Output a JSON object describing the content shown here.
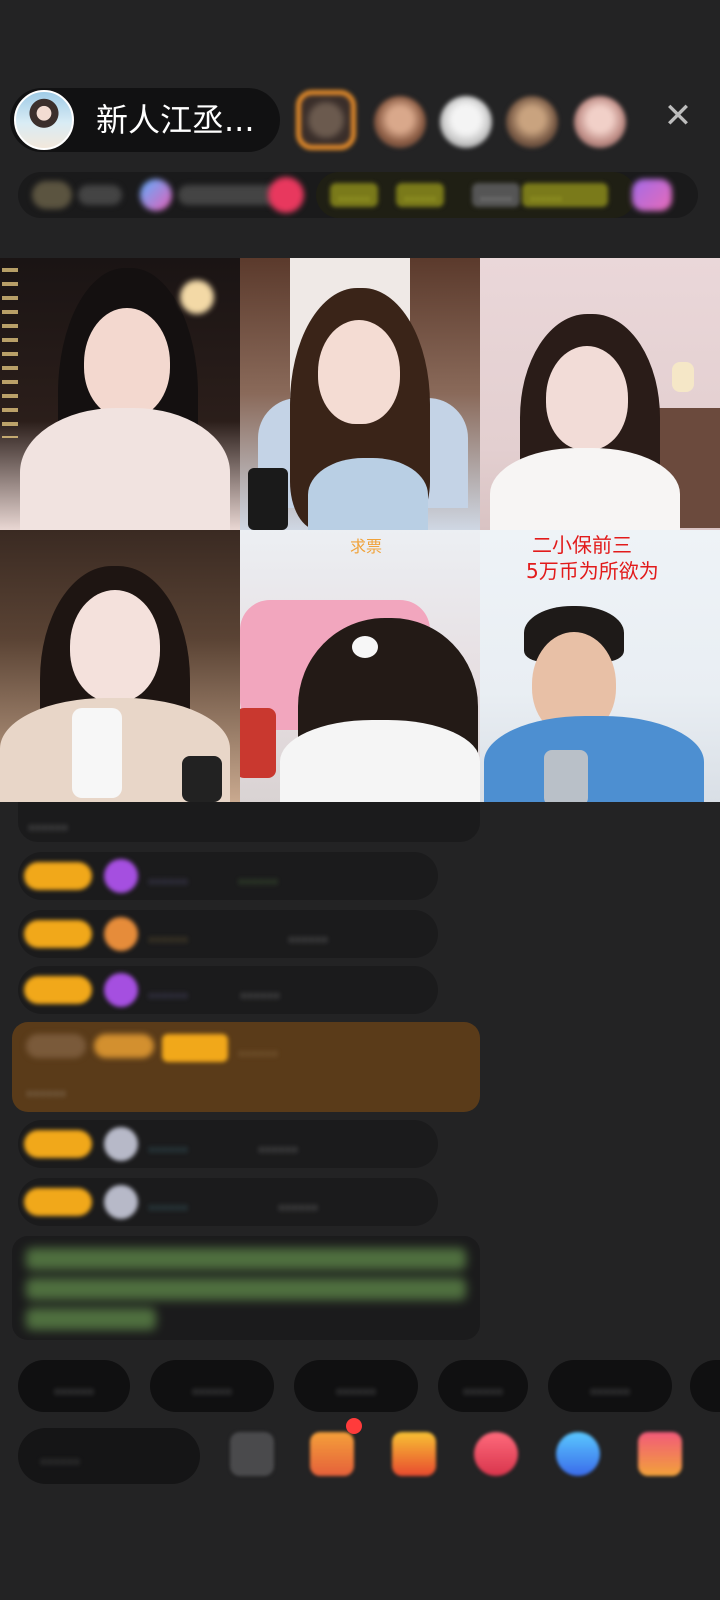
{
  "header": {
    "host_name": "新人江丞...",
    "close_icon": "close-icon",
    "viewer_count_avatars": 5
  },
  "rank_row": {
    "tags": [
      "……",
      "……",
      "……",
      "……"
    ]
  },
  "video_grid": {
    "tiles": [
      {
        "caption": ""
      },
      {
        "caption": ""
      },
      {
        "caption": ""
      },
      {
        "caption": ""
      },
      {
        "caption": "求票"
      },
      {
        "caption_line1": "二小保前三",
        "caption_line2": "5万币为所欲为"
      }
    ]
  },
  "chat": {
    "messages": [
      {
        "name": "……",
        "text": "……"
      },
      {
        "name": "……",
        "text": "……"
      },
      {
        "name": "……",
        "text": "……"
      },
      {
        "name": "……",
        "text": "……"
      },
      {
        "name": "……",
        "text": "……"
      },
      {
        "name": "……",
        "text": "……"
      },
      {
        "name": "……",
        "text": "……"
      }
    ]
  },
  "quick_replies": [
    "……",
    "……",
    "……",
    "……",
    "……"
  ],
  "toolbar": {
    "input_placeholder": "……",
    "icons": [
      "emoji-icon",
      "gift-box-icon",
      "treasure-icon",
      "red-packet-icon",
      "chat-bubble-icon",
      "more-icon"
    ]
  },
  "colors": {
    "background": "#232324",
    "badge": "#f1a81a",
    "system_message_bg": "#5a3b19",
    "green_text": "#8fd66a"
  }
}
